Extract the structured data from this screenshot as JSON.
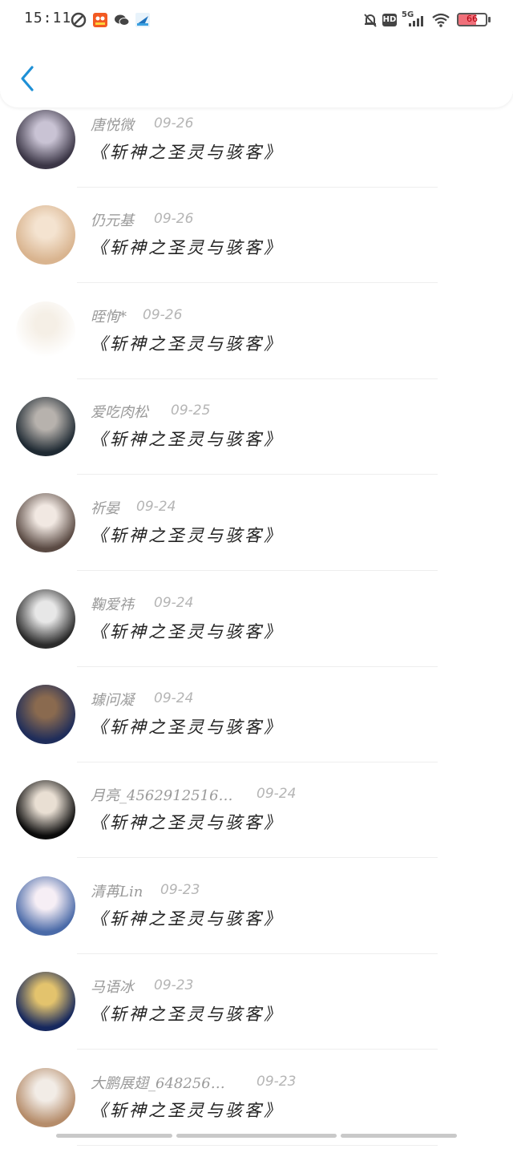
{
  "status_bar": {
    "time": "15:11",
    "network": "5G",
    "hd": "HD",
    "battery": "66",
    "battery_level": 0.66
  },
  "header": {
    "back_icon": "chevron-left-icon",
    "accent": "#1e90d6"
  },
  "items": [
    {
      "name": "唐悦微",
      "date": "09-26",
      "title": "《斩神之圣灵与骇客》",
      "avatar_bg": [
        "#3b3646",
        "#c9c3d4"
      ]
    },
    {
      "name": "仍元基",
      "date": "09-26",
      "title": "《斩神之圣灵与骇客》",
      "avatar_bg": [
        "#d9b48f",
        "#f4e3d0"
      ]
    },
    {
      "name": "晊恂*",
      "date": "09-26",
      "title": "《斩神之圣灵与骇客》",
      "avatar_bg": [
        "#ffffff",
        "#f5efe6"
      ]
    },
    {
      "name": "爱吃肉松",
      "date": "09-25",
      "title": "《斩神之圣灵与骇客》",
      "avatar_bg": [
        "#1f2a33",
        "#b7b2ad"
      ]
    },
    {
      "name": "祈晏",
      "date": "09-24",
      "title": "《斩神之圣灵与骇客》",
      "avatar_bg": [
        "#5a4a43",
        "#f1e8e2"
      ]
    },
    {
      "name": "鞠爱祎",
      "date": "09-24",
      "title": "《斩神之圣灵与骇客》",
      "avatar_bg": [
        "#2b2b2b",
        "#e7e7e7"
      ]
    },
    {
      "name": "璩问凝",
      "date": "09-24",
      "title": "《斩神之圣灵与骇客》",
      "avatar_bg": [
        "#1f2d5a",
        "#8a6a4f"
      ]
    },
    {
      "name": "月亮_4562912516…",
      "date": "09-24",
      "title": "《斩神之圣灵与骇客》",
      "avatar_bg": [
        "#0b0b0b",
        "#e9dfd3"
      ]
    },
    {
      "name": "清苒Lin",
      "date": "09-23",
      "title": "《斩神之圣灵与骇客》",
      "avatar_bg": [
        "#4a6aa8",
        "#f6eef5"
      ]
    },
    {
      "name": "马语冰",
      "date": "09-23",
      "title": "《斩神之圣灵与骇客》",
      "avatar_bg": [
        "#16285e",
        "#e3c36d"
      ]
    },
    {
      "name": "大鹏展翅_648256…",
      "date": "09-23",
      "title": "《斩神之圣灵与骇客》",
      "avatar_bg": [
        "#b58c6a",
        "#f2ece6"
      ]
    }
  ]
}
